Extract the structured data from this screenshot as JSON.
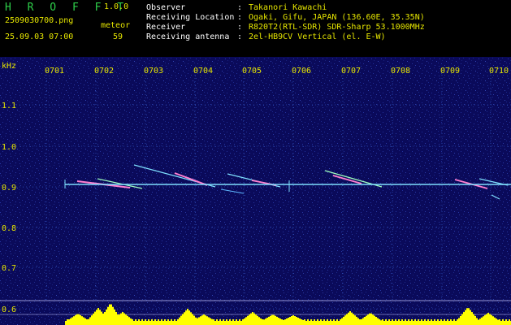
{
  "header": {
    "app_title": "H R O F F T",
    "app_version": "1.0.0",
    "file_name": "2509030700.png",
    "date_time": "25.09.03 07:00",
    "meteor_label": "meteor",
    "meteor_count": "59",
    "info": [
      {
        "key": "Observer",
        "value": "Takanori Kawachi"
      },
      {
        "key": "Receiving Location",
        "value": "Ogaki, Gifu, JAPAN (136.60E, 35.35N)"
      },
      {
        "key": "Receiver",
        "value": "R820T2(RTL-SDR) SDR-Sharp 53.1000MHz"
      },
      {
        "key": "Receiving antenna",
        "value": "2el-HB9CV Vertical (el. E-W)"
      }
    ]
  },
  "spectrogram": {
    "y_unit": "kHz",
    "y_ticks": [
      "1.1",
      "1.0",
      "0.9",
      "0.8",
      "0.7",
      "0.6"
    ],
    "x_ticks": [
      "0701",
      "0702",
      "0703",
      "0704",
      "0705",
      "0706",
      "0707",
      "0708",
      "0709",
      "0710"
    ],
    "colors": {
      "background": "#0a0a5a",
      "grid": "#3a6ad8",
      "carrier": "#7fe0ff",
      "label": "#e6e600",
      "activity": "#ffff00"
    }
  }
}
